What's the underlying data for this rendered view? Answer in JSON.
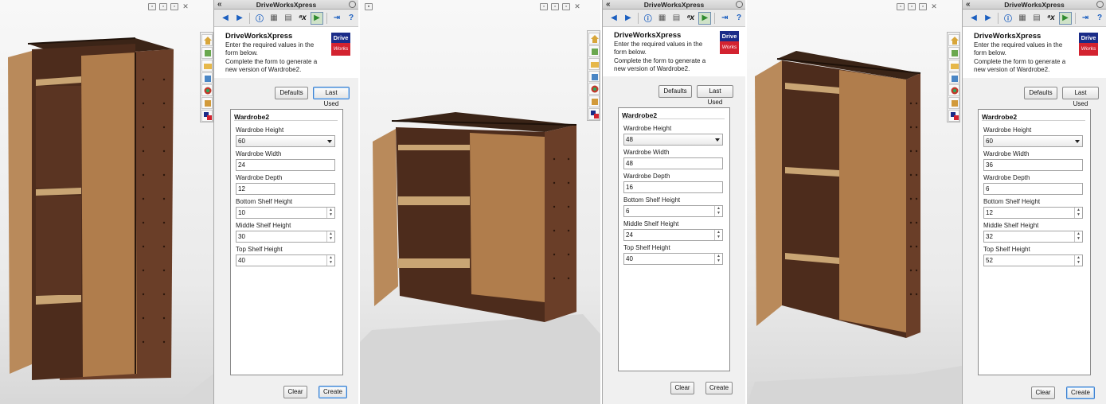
{
  "app": {
    "panel_title": "DriveWorksXpress",
    "collapse_glyph": "«"
  },
  "toolbar": {
    "icons": [
      "back-arrow-icon",
      "forward-arrow-icon",
      "info-icon",
      "form-icon",
      "table-icon",
      "rules-icon",
      "run-icon",
      "pin-icon",
      "help-icon"
    ],
    "rules_label": "ᵃx"
  },
  "header": {
    "title": "DriveWorksXpress",
    "desc_line1": "Enter the required values in the form below.",
    "desc_line2": "Complete the form to generate a new version of Wardrobe2.",
    "logo_top": "Drive",
    "logo_bottom": "Works"
  },
  "buttons": {
    "defaults": "Defaults",
    "last_used": "Last Used",
    "clear": "Clear",
    "create": "Create"
  },
  "form": {
    "title": "Wardrobe2",
    "labels": {
      "height": "Wardrobe Height",
      "width": "Wardrobe Width",
      "depth": "Wardrobe Depth",
      "bottom": "Bottom Shelf Height",
      "middle": "Middle Shelf Height",
      "top": "Top Shelf Height"
    }
  },
  "configs": [
    {
      "height": "60",
      "width": "24",
      "depth": "12",
      "bottom": "10",
      "middle": "30",
      "top": "40"
    },
    {
      "height": "48",
      "width": "48",
      "depth": "16",
      "bottom": "6",
      "middle": "24",
      "top": "40"
    },
    {
      "height": "60",
      "width": "36",
      "depth": "6",
      "bottom": "12",
      "middle": "32",
      "top": "52"
    }
  ],
  "colors": {
    "wood_dark": "#4a2a1a",
    "wood_light": "#b98a5b",
    "panel_bg": "#f0f0f0",
    "logo_blue": "#1b2c88",
    "logo_red": "#d32330"
  }
}
